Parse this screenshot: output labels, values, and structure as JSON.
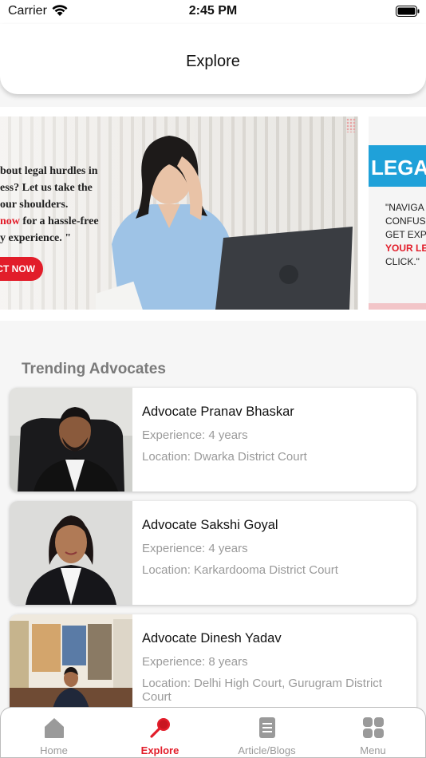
{
  "status_bar": {
    "carrier": "Carrier",
    "time": "2:45 PM"
  },
  "header": {
    "title": "Explore"
  },
  "banners": [
    {
      "lines": [
        "bout legal hurdles in",
        "ess? Let us take the",
        "our shoulders."
      ],
      "red_word": "now",
      "line4_rest": " for a hassle-free",
      "line5": "y experience. \"",
      "cta": "CT NOW"
    },
    {
      "heading": "LEGA",
      "lines": [
        "\"NAVIGA",
        "CONFUSI",
        "GET EXPE"
      ],
      "red_line": "YOUR LE",
      "last_line": "CLICK.\""
    }
  ],
  "section": {
    "title": "Trending Advocates"
  },
  "advocates": [
    {
      "name": "Advocate Pranav Bhaskar",
      "experience": "Experience: 4 years",
      "location": "Location: Dwarka District Court"
    },
    {
      "name": "Advocate Sakshi Goyal",
      "experience": "Experience: 4 years",
      "location": "Location: Karkardooma District Court"
    },
    {
      "name": "Advocate Dinesh Yadav",
      "experience": "Experience: 8 years",
      "location": "Location: Delhi High Court, Gurugram District Court"
    }
  ],
  "tabs": [
    {
      "label": "Home",
      "icon": "home-icon",
      "active": false
    },
    {
      "label": "Explore",
      "icon": "explore-icon",
      "active": true
    },
    {
      "label": "Article/Blogs",
      "icon": "document-icon",
      "active": false
    },
    {
      "label": "Menu",
      "icon": "grid-menu-icon",
      "active": false
    }
  ],
  "colors": {
    "accent": "#e21d2a",
    "inactive": "#9a9a9a",
    "banner_blue": "#1fa1d9"
  }
}
